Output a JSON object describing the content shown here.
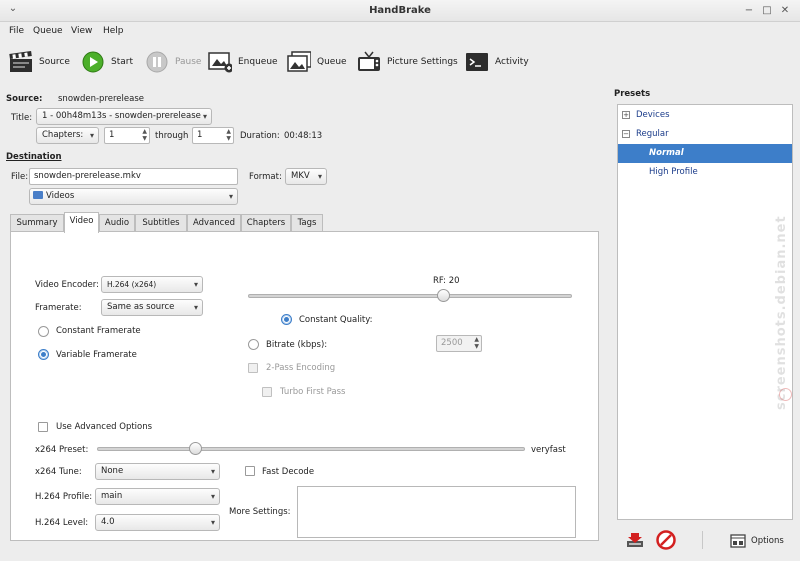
{
  "window": {
    "title": "HandBrake"
  },
  "menu": [
    "File",
    "Queue",
    "View",
    "Help"
  ],
  "toolbar": {
    "source": "Source",
    "start": "Start",
    "pause": "Pause",
    "enqueue": "Enqueue",
    "queue": "Queue",
    "picture_settings": "Picture Settings",
    "activity": "Activity"
  },
  "source": {
    "label": "Source:",
    "name": "snowden-prerelease",
    "title_label": "Title:",
    "title_value": "1 - 00h48m13s - snowden-prerelease",
    "chapters_mode": "Chapters:",
    "chapter_start": "1",
    "through_label": "through",
    "chapter_end": "1",
    "duration_label": "Duration:",
    "duration_value": "00:48:13"
  },
  "destination": {
    "label": "Destination",
    "file_label": "File:",
    "file_value": "snowden-prerelease.mkv",
    "format_label": "Format:",
    "format_value": "MKV",
    "folder_value": "Videos"
  },
  "tabs": [
    "Summary",
    "Video",
    "Audio",
    "Subtitles",
    "Advanced",
    "Chapters",
    "Tags"
  ],
  "video": {
    "encoder_label": "Video Encoder:",
    "encoder_value": "H.264 (x264)",
    "framerate_label": "Framerate:",
    "framerate_value": "Same as source",
    "constant_framerate": "Constant Framerate",
    "variable_framerate": "Variable Framerate",
    "rf_label": "RF: 20",
    "constant_quality": "Constant Quality:",
    "bitrate_label": "Bitrate (kbps):",
    "bitrate_value": "2500",
    "two_pass": "2-Pass Encoding",
    "turbo_first_pass": "Turbo First Pass",
    "use_advanced": "Use Advanced Options",
    "x264_preset_label": "x264 Preset:",
    "x264_preset_value": "veryfast",
    "x264_tune_label": "x264 Tune:",
    "x264_tune_value": "None",
    "fast_decode": "Fast Decode",
    "profile_label": "H.264 Profile:",
    "profile_value": "main",
    "level_label": "H.264 Level:",
    "level_value": "4.0",
    "more_settings_label": "More Settings:"
  },
  "presets": {
    "header": "Presets",
    "items": [
      {
        "label": "Devices",
        "type": "group",
        "expander": "+"
      },
      {
        "label": "Regular",
        "type": "group",
        "expander": "−"
      },
      {
        "label": "Normal",
        "type": "item"
      },
      {
        "label": "High Profile",
        "type": "item"
      }
    ],
    "options_label": "Options"
  },
  "watermark": "screenshots.debian.net",
  "colors": {
    "selection": "#3d7ec9",
    "start_green": "#4caf2a",
    "delete_red": "#d32020"
  }
}
